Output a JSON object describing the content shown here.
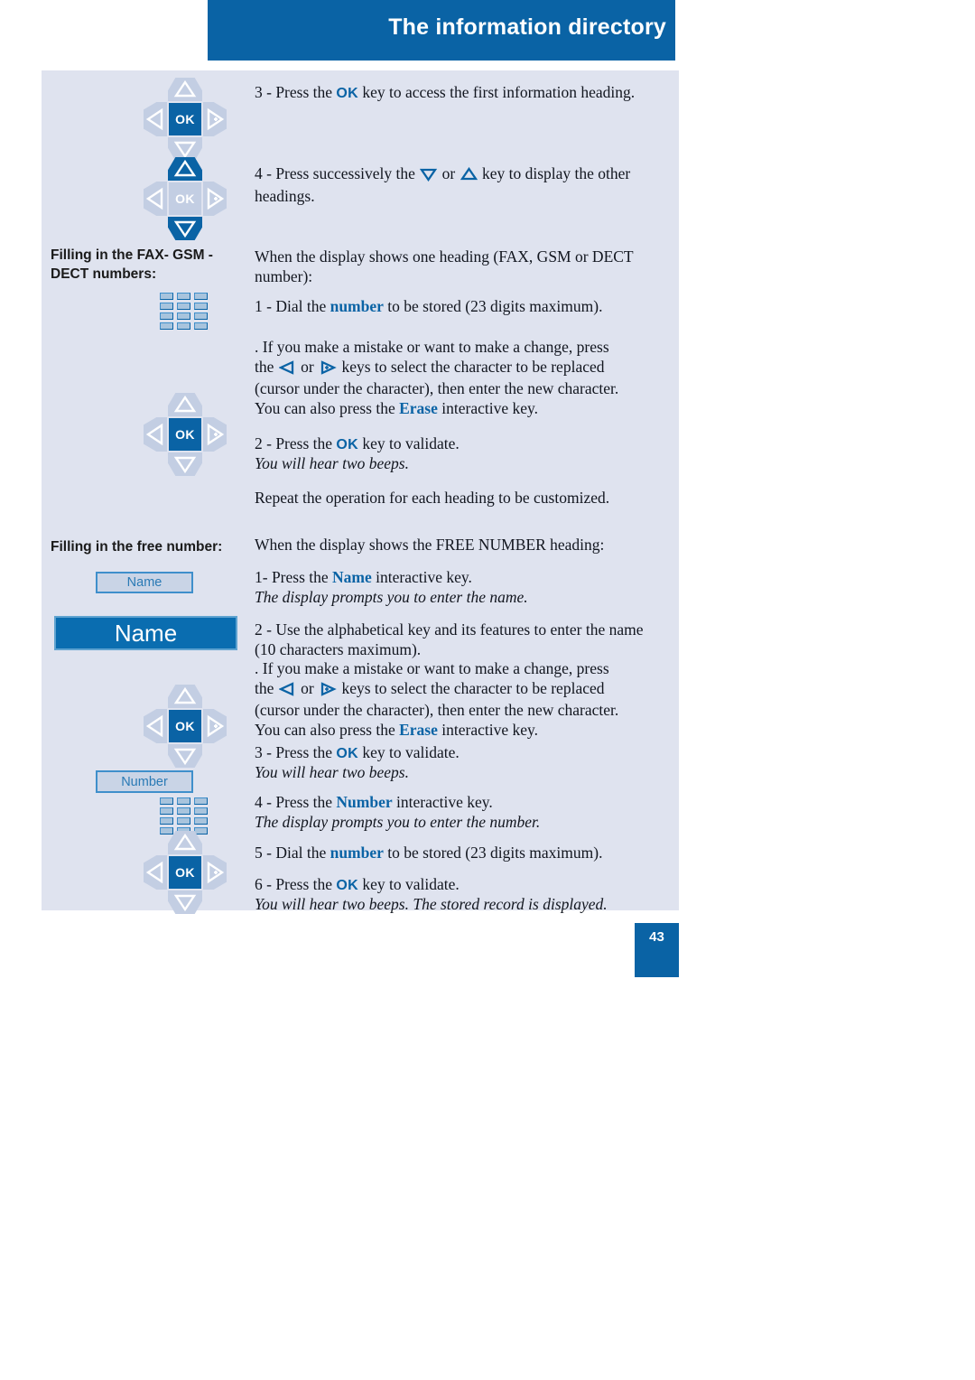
{
  "header": {
    "title": "The information directory"
  },
  "page": {
    "number": "43"
  },
  "sidebar": {
    "heading_fax": "Filling in the FAX- GSM - DECT numbers:",
    "heading_fax_line1": "Filling in the FAX- GSM -",
    "heading_fax_line2": "DECT numbers:",
    "heading_free": "Filling in the free number:",
    "softkey_name": "Name",
    "bigbar_name": "Name",
    "softkey_number": "Number",
    "ok_label": "OK"
  },
  "body": {
    "step3_access": {
      "prefix": "3 - Press the ",
      "key": "OK",
      "suffix": " key to access the first information heading."
    },
    "step4_headings": {
      "prefix": "4 - Press successively the ",
      "mid": " or ",
      "suffix": " key to display the other headings."
    },
    "fax_intro": "When the display shows one heading (FAX, GSM or DECT number):",
    "fax_step1": {
      "prefix": "1 - Dial the ",
      "key": "number",
      "suffix": " to be stored (23 digits maximum)."
    },
    "mistake_note": {
      "line1": ". If you make a mistake or want to make a change, press",
      "line2_prefix": "the ",
      "line2_mid": " or ",
      "line2_suffix": " keys to select the character to be replaced",
      "line3": "(cursor under the character), then enter the new character.",
      "line4_prefix": "You can also press the ",
      "line4_key": "Erase",
      "line4_suffix": " interactive key."
    },
    "fax_step2": {
      "prefix": "2 - Press the ",
      "key": "OK",
      "suffix": " key to validate."
    },
    "two_beeps": "You will hear two beeps.",
    "repeat_note": "Repeat the operation for each heading to be customized.",
    "free_intro": "When the display shows the FREE NUMBER heading:",
    "free_step1": {
      "prefix": "1- Press the ",
      "key": "Name",
      "suffix": " interactive key."
    },
    "prompt_name": "The display prompts you to enter the name.",
    "free_step2": {
      "line1": "2 - Use the alphabetical key and its features to enter the name",
      "line2": "(10 characters maximum)."
    },
    "free_step3": {
      "prefix": "3 - Press the ",
      "key": "OK",
      "suffix": " key to validate."
    },
    "free_step4": {
      "prefix": "4 - Press the ",
      "key": "Number",
      "suffix": " interactive key."
    },
    "prompt_number": "The display prompts you to enter the number.",
    "free_step5": {
      "prefix": "5 - Dial the ",
      "key": "number",
      "suffix": " to be stored (23 digits maximum)."
    },
    "free_step6": {
      "prefix": "6 - Press the ",
      "key": "OK",
      "suffix": " key to validate."
    },
    "final_note": "You will hear two beeps. The stored record is displayed."
  },
  "colors": {
    "brand_blue": "#0a63a5",
    "panel_bg": "#dfe3ef",
    "icon_light": "#c3cee3"
  }
}
